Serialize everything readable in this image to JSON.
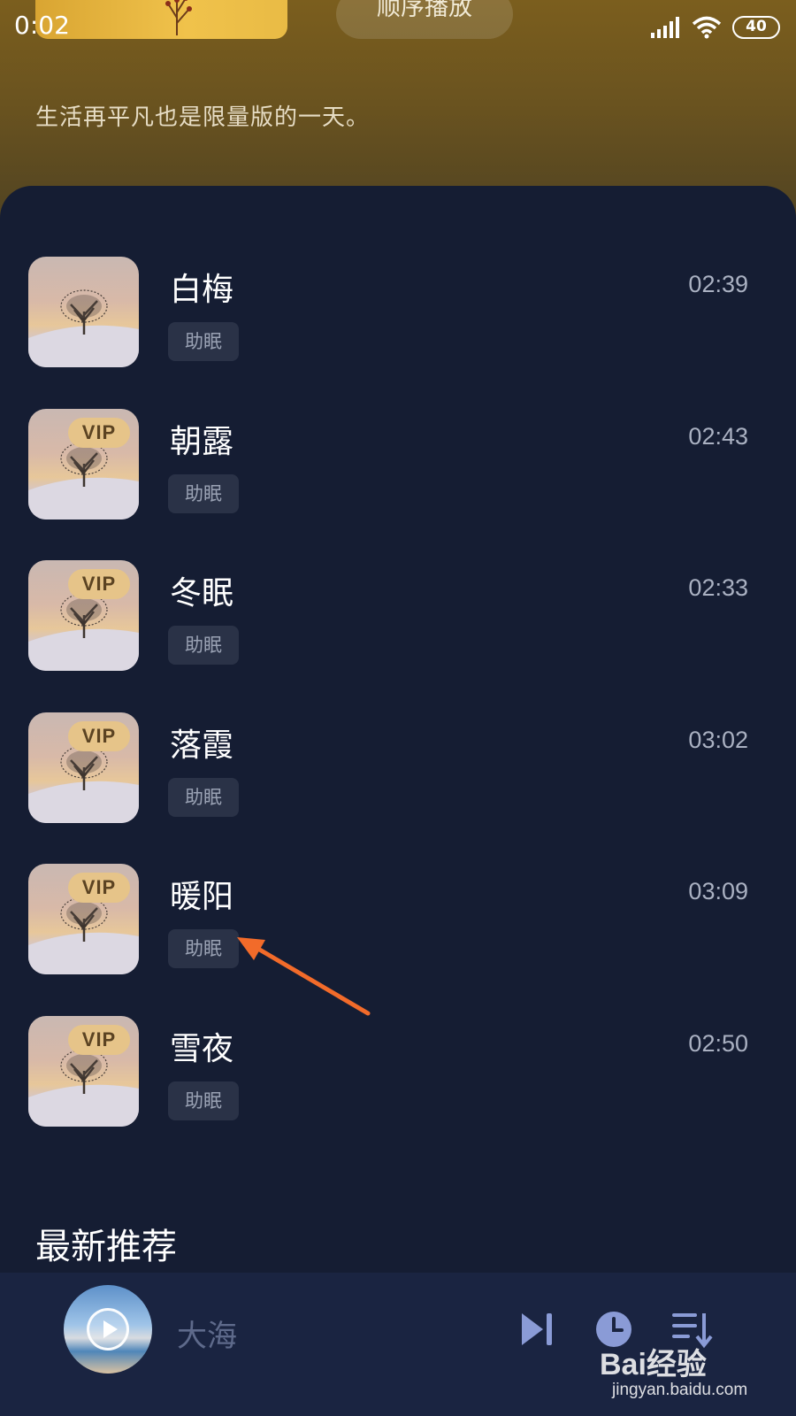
{
  "status_bar": {
    "time": "0:02",
    "battery": "40"
  },
  "header": {
    "play_order_label": "顺序播放",
    "slogan": "生活再平凡也是限量版的一天。"
  },
  "tracks": [
    {
      "title": "白梅",
      "tag": "助眠",
      "duration": "02:39",
      "vip": false
    },
    {
      "title": "朝露",
      "tag": "助眠",
      "duration": "02:43",
      "vip": true,
      "vip_label": "VIP"
    },
    {
      "title": "冬眠",
      "tag": "助眠",
      "duration": "02:33",
      "vip": true,
      "vip_label": "VIP"
    },
    {
      "title": "落霞",
      "tag": "助眠",
      "duration": "03:02",
      "vip": true,
      "vip_label": "VIP"
    },
    {
      "title": "暖阳",
      "tag": "助眠",
      "duration": "03:09",
      "vip": true,
      "vip_label": "VIP"
    },
    {
      "title": "雪夜",
      "tag": "助眠",
      "duration": "02:50",
      "vip": true,
      "vip_label": "VIP"
    }
  ],
  "section": {
    "latest_label": "最新推荐"
  },
  "player": {
    "current_title": "大海",
    "icons": [
      "play-icon",
      "skip-next-icon",
      "timer-icon",
      "playlist-icon"
    ]
  },
  "watermark": {
    "brand": "Bai经验",
    "url": "jingyan.baidu.com"
  },
  "colors": {
    "header_gold": "#7b5e1e",
    "background": "#151d33",
    "vip_badge": "#e6c489",
    "annotation_arrow": "#f26b2a"
  }
}
